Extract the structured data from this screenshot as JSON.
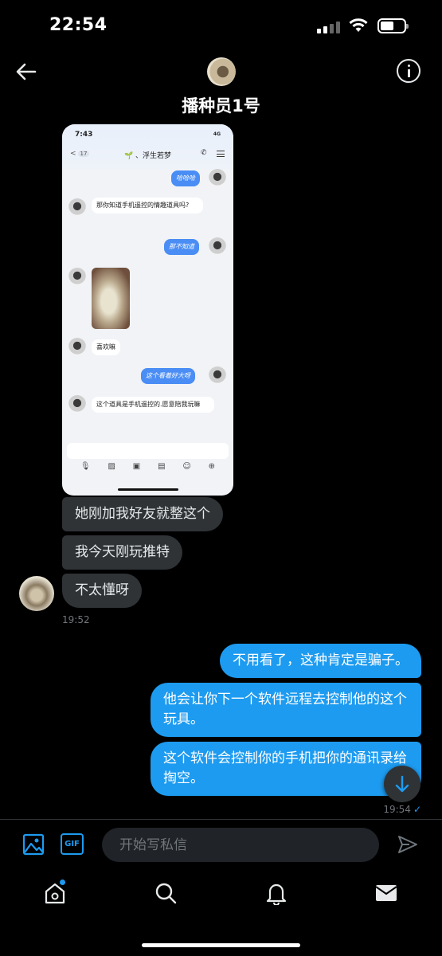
{
  "status_bar": {
    "time": "22:54"
  },
  "header": {
    "name": "播种员1号"
  },
  "screenshot": {
    "time": "7:43",
    "status": "4G",
    "badge": "17",
    "title": "🌱 、浮生若梦",
    "messages": [
      {
        "dir": "out",
        "text": "哈哈哈"
      },
      {
        "dir": "in",
        "text": "那你知道手机遥控的情趣道具吗?"
      },
      {
        "dir": "out",
        "text": "那不知道"
      },
      {
        "dir": "in",
        "text": "喜欢嘛"
      },
      {
        "dir": "out",
        "text": "这个看着好大呀"
      },
      {
        "dir": "in",
        "text": "这个道具是手机遥控的.愿意陪我玩嘛"
      }
    ]
  },
  "chat": {
    "incoming": [
      "她刚加我好友就整这个",
      "我今天刚玩推特",
      "不太懂呀"
    ],
    "incoming_time": "19:52",
    "outgoing": [
      "不用看了，这种肯定是骗子。",
      "他会让你下一个软件远程去控制他的这个玩具。",
      "这个软件会控制你的手机把你的通讯录给掏空。"
    ],
    "outgoing_time": "19:54",
    "read_mark": "✓"
  },
  "composer": {
    "placeholder": "开始写私信",
    "gif_label": "GIF"
  },
  "colors": {
    "accent": "#1d9bf0",
    "incoming_bubble": "#2f3336",
    "background": "#000000"
  },
  "icons": [
    "back-arrow-icon",
    "info-icon",
    "image-icon",
    "gif-icon",
    "send-icon",
    "home-icon",
    "search-icon",
    "bell-icon",
    "mail-icon"
  ]
}
